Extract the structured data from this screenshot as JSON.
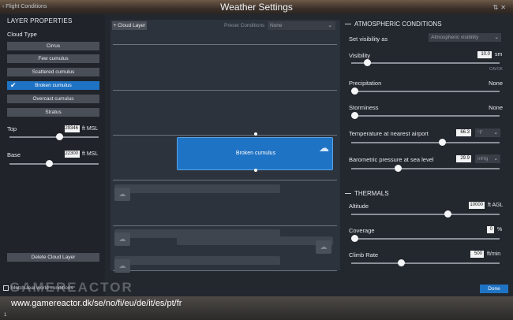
{
  "window": {
    "back_label": "Flight Conditions",
    "title": "Weather Settings",
    "icons": [
      "pin-icon",
      "close-icon"
    ]
  },
  "layer_properties": {
    "title": "LAYER PROPERTIES",
    "cloud_type_label": "Cloud Type",
    "cloud_types": [
      {
        "label": "Cirrus",
        "selected": false
      },
      {
        "label": "Few cumulus",
        "selected": false
      },
      {
        "label": "Scattered cumulus",
        "selected": false
      },
      {
        "label": "Broken cumulus",
        "selected": true
      },
      {
        "label": "Overcast cumulus",
        "selected": false
      },
      {
        "label": "Stratus",
        "selected": false
      }
    ],
    "top": {
      "label": "Top",
      "value": "29346",
      "unit": "ft MSL",
      "slider": 0.57
    },
    "base": {
      "label": "Base",
      "value": "22300",
      "unit": "ft MSL",
      "slider": 0.44
    },
    "delete_label": "Delete Cloud Layer"
  },
  "center": {
    "add_label": "+ Cloud Layer",
    "preset_label": "Preset Conditions",
    "preset_value": "None",
    "selected_layer_name": "Broken cumulus"
  },
  "atmospheric": {
    "title": "ATMOSPHERIC CONDITIONS",
    "visibility_as_label": "Set visibility as",
    "visibility_as_value": "Atmospheric visibility",
    "visibility": {
      "label": "Visibility",
      "value": "10.0",
      "unit": "sm",
      "format": "CAVOK",
      "slider": 0.09
    },
    "precipitation": {
      "label": "Precipitation",
      "value": "None",
      "slider": 0.0
    },
    "storminess": {
      "label": "Storminess",
      "value": "None",
      "slider": 0.0
    },
    "temperature": {
      "label": "Temperature at nearest airport",
      "value": "66.3",
      "unit": "°F",
      "slider": 0.62
    },
    "pressure": {
      "label": "Barometric pressure at sea level",
      "value": "29.9",
      "unit": "inHg",
      "slider": 0.31
    }
  },
  "thermals": {
    "title": "THERMALS",
    "altitude": {
      "label": "Altitude",
      "value": "10000",
      "unit": "ft AGL",
      "slider": 0.66
    },
    "coverage": {
      "label": "Coverage",
      "value": "0",
      "unit": "%",
      "slider": 0.0
    },
    "climb_rate": {
      "label": "Climb Rate",
      "value": "500",
      "unit": "ft/min",
      "slider": 0.33
    }
  },
  "footer": {
    "match_label": "Match real world conditions",
    "done_label": "Done",
    "watermark": "GAMEREACTOR",
    "site_url": "www.gamereactor.dk/se/no/fi/eu/de/it/es/pt/fr",
    "page_number": "1"
  },
  "colors": {
    "accent": "#1f73c4",
    "panel": "#23272e",
    "button": "#4a4f57"
  }
}
